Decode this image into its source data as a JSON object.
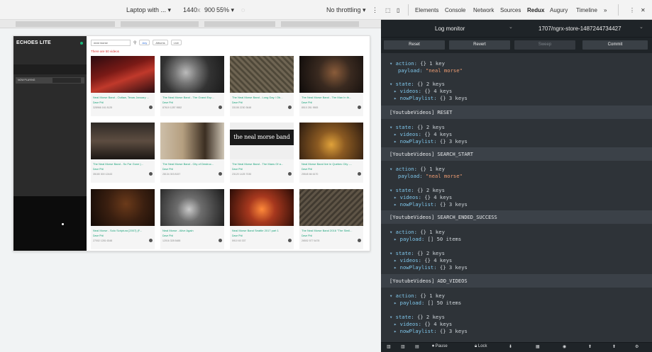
{
  "emulation": {
    "device": "Laptop with ...",
    "width": "1440",
    "x": "x",
    "height": "900",
    "zoom": "55%",
    "throttling": "No throttling"
  },
  "app": {
    "brand": "ECHOES LITE",
    "now_playing": "NOW PLAYING",
    "search_value": "neal morse",
    "filters": [
      "Any",
      "Albums",
      "Live"
    ],
    "results_text": "There are 50 videos",
    "videos": [
      {
        "title": "Neal Morse Band - Outlaw, Texas January ...",
        "user": "Dave Phil",
        "stats": "328966  161  8125"
      },
      {
        "title": "The Neal Morse Band - The Grand Exp...",
        "user": "Dave Phil",
        "stats": "87619  1287  9582"
      },
      {
        "title": "The Neal Morse Band - Long Day / Ob...",
        "user": "Dave Phil",
        "stats": "33108  2230  3648"
      },
      {
        "title": "The Neal Morse Band - The Man In th...",
        "user": "Dave Phil",
        "stats": "8510  281  9583"
      },
      {
        "title": "The Neal Morse Band - So Far Gone |...",
        "user": "Dave Phil",
        "stats": "35180  300  12443"
      },
      {
        "title": "The Neal Morse Band - City of Destruc...",
        "user": "Dave Phil",
        "stats": "28134  303  8157"
      },
      {
        "title": "The Neal Morse Band - The Mans Of a...",
        "user": "Dave Phil",
        "stats": "23120  1425  7030"
      },
      {
        "title": "Neal Morse Band live in Quebec City -...",
        "user": "Dave Phil",
        "stats": "25545  66  6170"
      },
      {
        "title": "Neal Morse - Solo Scriptura [2007] (F...",
        "user": "Dave Phil",
        "stats": "27002  1281  6348"
      },
      {
        "title": "Neal Morse - Alive Again",
        "user": "Dave Phil",
        "stats": "12016  328  5488"
      },
      {
        "title": "Neal Morse Band Seattle 2017 part 1",
        "user": "Dave Phil",
        "stats": "5910  60  337"
      },
      {
        "title": "The Neal Morse Band 2016 \"The Simil...",
        "user": "Dave Phil",
        "stats": "26502  577  6478"
      }
    ],
    "band_logo_text": "the neal morse band"
  },
  "devtools": {
    "tabs": [
      "Elements",
      "Console",
      "Network",
      "Sources",
      "Redux",
      "Augury",
      "Timeline"
    ],
    "selected_tab": "Redux",
    "more": "»",
    "menu": "⋮",
    "close": "✕",
    "monitor": "Log monitor",
    "store": "1707/ngrx-store-1487244734427",
    "buttons": {
      "reset": "Reset",
      "revert": "Revert",
      "sweep": "Sweep",
      "commit": "Commit"
    },
    "log": {
      "l1_key": "action",
      "l1_meta": "{} 1 key",
      "l2_key": "payload",
      "l2_str": "\"neal morse\"",
      "l3_key": "state",
      "l3_meta": "{} 2 keys",
      "l4_key": "videos",
      "l4_meta": "{} 4 keys",
      "l5_key": "nowPlaylist",
      "l5_meta": "{} 3 keys",
      "s1": "[YoutubeVideos] RESET",
      "l6_key": "state",
      "l6_meta": "{} 2 keys",
      "l7_key": "videos",
      "l7_meta": "{} 4 keys",
      "l8_key": "nowPlaylist",
      "l8_meta": "{} 3 keys",
      "s2": "[YoutubeVideos] SEARCH_START",
      "l9_key": "action",
      "l9_meta": "{} 1 key",
      "l10_key": "payload",
      "l10_str": "\"neal morse\"",
      "l11_key": "state",
      "l11_meta": "{} 2 keys",
      "l12_key": "videos",
      "l12_meta": "{} 4 keys",
      "l13_key": "nowPlaylist",
      "l13_meta": "{} 3 keys",
      "s3": "[YoutubeVideos] SEARCH_ENDED_SUCCESS",
      "l14_key": "action",
      "l14_meta": "{} 1 key",
      "l15_key": "payload",
      "l15_meta": "[] 50 items",
      "l16_key": "state",
      "l16_meta": "{} 2 keys",
      "l17_key": "videos",
      "l17_meta": "{} 4 keys",
      "l18_key": "nowPlaylist",
      "l18_meta": "{} 3 keys",
      "s4": "[YoutubeVideos] ADD_VIDEOS",
      "l19_key": "action",
      "l19_meta": "{} 1 key",
      "l20_key": "payload",
      "l20_meta": "[] 50 items",
      "l21_key": "state",
      "l21_meta": "{} 2 keys",
      "l22_key": "videos",
      "l22_meta": "{} 4 keys",
      "l23_key": "nowPlaylist",
      "l23_meta": "{} 3 keys"
    },
    "footer": {
      "pause": "Pause",
      "lock": "Lock"
    }
  }
}
